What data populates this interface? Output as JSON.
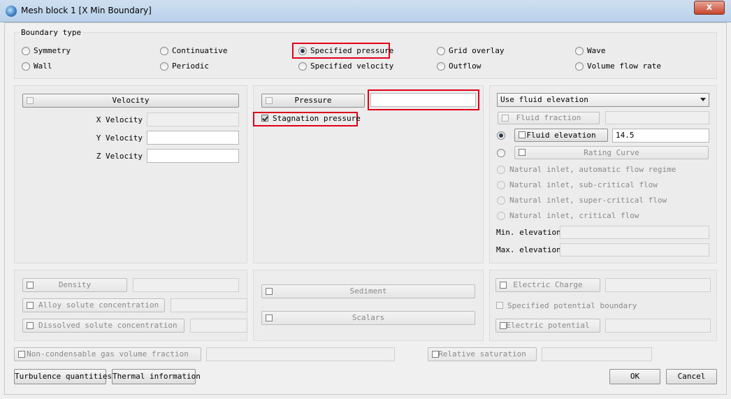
{
  "window": {
    "title": "Mesh block 1 [X Min Boundary]",
    "close_glyph": "x"
  },
  "boundary_type": {
    "legend": "Boundary type",
    "options": [
      {
        "label": "Symmetry"
      },
      {
        "label": "Continuative"
      },
      {
        "label": "Specified pressure"
      },
      {
        "label": "Grid overlay"
      },
      {
        "label": "Wave"
      },
      {
        "label": "Wall"
      },
      {
        "label": "Periodic"
      },
      {
        "label": "Specified velocity"
      },
      {
        "label": "Outflow"
      },
      {
        "label": "Volume flow rate"
      }
    ],
    "selected": "Specified pressure"
  },
  "velocity": {
    "button": "Velocity",
    "x_label": "X Velocity",
    "x_value": "",
    "y_label": "Y Velocity",
    "y_value": "",
    "z_label": "Z Velocity",
    "z_value": ""
  },
  "pressure": {
    "button": "Pressure",
    "value": "",
    "stagnation_label": "Stagnation pressure",
    "stagnation_checked": true
  },
  "fluid": {
    "dropdown_value": "Use fluid elevation",
    "fluid_fraction_label": "Fluid fraction",
    "fluid_elevation_label": "Fluid elevation",
    "fluid_elevation_value": "14.5",
    "rating_curve_label": "Rating Curve",
    "options": [
      "Natural inlet, automatic flow regime",
      "Natural inlet, sub-critical flow",
      "Natural inlet, super-critical flow",
      "Natural inlet, critical flow"
    ],
    "min_elevation_label": "Min. elevation",
    "max_elevation_label": "Max. elevation"
  },
  "lower_left": {
    "density_label": "Density",
    "alloy_label": "Alloy solute concentration",
    "dissolved_label": "Dissolved solute concentration"
  },
  "lower_middle": {
    "sediment_label": "Sediment",
    "scalars_label": "Scalars"
  },
  "lower_right": {
    "electric_charge_label": "Electric Charge",
    "specified_potential_label": "Specified potential boundary",
    "electric_potential_label": "Electric potential"
  },
  "bottom_row": {
    "non_condensable_label": "Non-condensable gas volume fraction",
    "relative_saturation_label": "Relative saturation"
  },
  "footer": {
    "turbulence_label": "Turbulence quantities",
    "thermal_label": "Thermal information",
    "ok_label": "OK",
    "cancel_label": "Cancel"
  },
  "colors": {
    "highlight": "#e0001b",
    "titlebar": "#b9d1ea"
  }
}
